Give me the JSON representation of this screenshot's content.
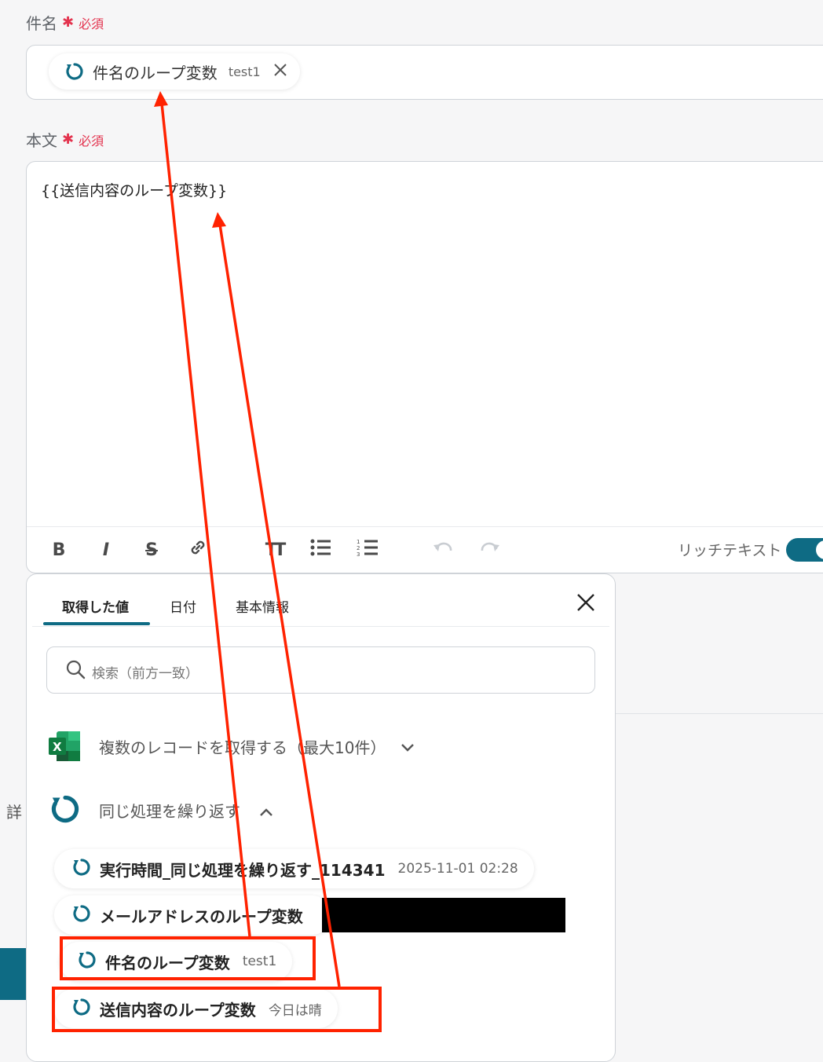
{
  "subject": {
    "label": "件名",
    "required": "必須",
    "chip": {
      "name": "件名のループ変数",
      "value": "test1"
    }
  },
  "body": {
    "label": "本文",
    "required": "必須",
    "content": "{{送信内容のループ変数}}"
  },
  "toolbar": {
    "bold": "B",
    "italic": "I",
    "strike": "S",
    "heading": "TT",
    "rich_text_label": "リッチテキスト"
  },
  "popup": {
    "tabs": [
      {
        "label": "取得した値",
        "active": true
      },
      {
        "label": "日付"
      },
      {
        "label": "基本情報"
      }
    ],
    "search_placeholder": "検索（前方一致）",
    "groups": [
      {
        "label": "複数のレコードを取得する（最大10件）",
        "icon": "excel-icon",
        "expanded": false
      },
      {
        "label": "同じ処理を繰り返す",
        "icon": "loop-icon",
        "expanded": true
      }
    ],
    "items": [
      {
        "name": "実行時間_同じ処理を繰り返す_114341",
        "value": "2025-11-01 02:28"
      },
      {
        "name": "メールアドレスのループ変数",
        "value": ""
      },
      {
        "name": "件名のループ変数",
        "value": "test1"
      },
      {
        "name": "送信内容のループ変数",
        "value": "今日は晴"
      }
    ]
  },
  "side_label": "詳",
  "colors": {
    "accent": "#0e6b84",
    "required": "#e3334e",
    "annotation": "#ff2200"
  }
}
